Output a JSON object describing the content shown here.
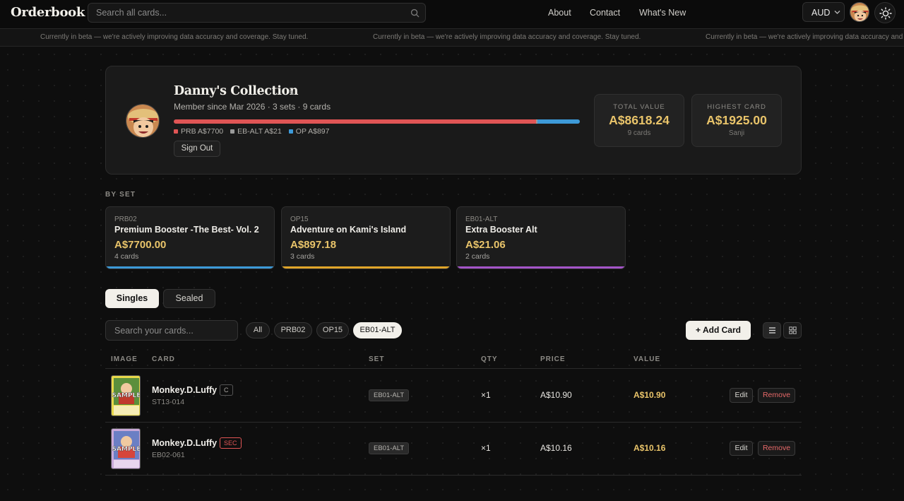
{
  "brand": {
    "logo": "Orderbook"
  },
  "search": {
    "placeholder": "Search all cards..."
  },
  "nav": {
    "about": "About",
    "contact": "Contact",
    "whats_new": "What's New"
  },
  "currency": {
    "selected": "AUD"
  },
  "banner": {
    "message": "Currently in beta — we're actively improving data accuracy and coverage. Stay tuned."
  },
  "profile": {
    "title": "Danny's Collection",
    "edit_icon": "✎",
    "subtitle": "Member since Mar 2026 · 3 sets · 9 cards",
    "breakdown": [
      {
        "label": "PRB A$7700",
        "color": "#e05555",
        "share": 0.893
      },
      {
        "label": "EB-ALT A$21",
        "color": "#9a9a9a",
        "share": 0.003
      },
      {
        "label": "OP A$897",
        "color": "#3d9ad8",
        "share": 0.104
      }
    ],
    "sign_out": "Sign Out",
    "stats": {
      "total": {
        "label": "TOTAL VALUE",
        "value": "A$8618.24",
        "sub": "9 cards"
      },
      "highest": {
        "label": "HIGHEST CARD",
        "value": "A$1925.00",
        "sub": "Sanji"
      }
    }
  },
  "by_set": {
    "label": "BY SET",
    "sets": [
      {
        "code": "PRB02",
        "name": "Premium Booster -The Best- Vol. 2",
        "value": "A$7700.00",
        "count": "4 cards",
        "color": "#3d9ad8"
      },
      {
        "code": "OP15",
        "name": "Adventure on Kami's Island",
        "value": "A$897.18",
        "count": "3 cards",
        "color": "#e0a52a"
      },
      {
        "code": "EB01-ALT",
        "name": "Extra Booster Alt",
        "value": "A$21.06",
        "count": "2 cards",
        "color": "#a455c9"
      }
    ]
  },
  "tabs": {
    "singles": "Singles",
    "sealed": "Sealed"
  },
  "filters": {
    "search_placeholder": "Search your cards...",
    "chips": [
      "All",
      "PRB02",
      "OP15",
      "EB01-ALT"
    ],
    "active": "EB01-ALT",
    "add_card": "+ Add Card"
  },
  "table": {
    "headers": {
      "image": "IMAGE",
      "card": "CARD",
      "set": "SET",
      "qty": "QTY",
      "price": "PRICE",
      "value": "VALUE"
    },
    "rows": [
      {
        "name": "Monkey.D.Luffy",
        "rarity": "C",
        "code": "ST13-014",
        "set": "EB01-ALT",
        "qty": "×1",
        "price": "A$10.90",
        "value": "A$10.90",
        "edit": "Edit",
        "remove": "Remove"
      },
      {
        "name": "Monkey.D.Luffy",
        "rarity": "SEC",
        "code": "EB02-061",
        "set": "EB01-ALT",
        "qty": "×1",
        "price": "A$10.16",
        "value": "A$10.16",
        "edit": "Edit",
        "remove": "Remove"
      }
    ]
  },
  "icons": {
    "search": "search-icon",
    "chevron": "chevron-down-icon",
    "theme": "sun-icon",
    "list_view": "list-view-icon",
    "grid_view": "grid-view-icon"
  },
  "colors": {
    "accent_gold": "#e9c46a",
    "danger": "#e86a6a",
    "rarity_sec": "#e05555"
  }
}
